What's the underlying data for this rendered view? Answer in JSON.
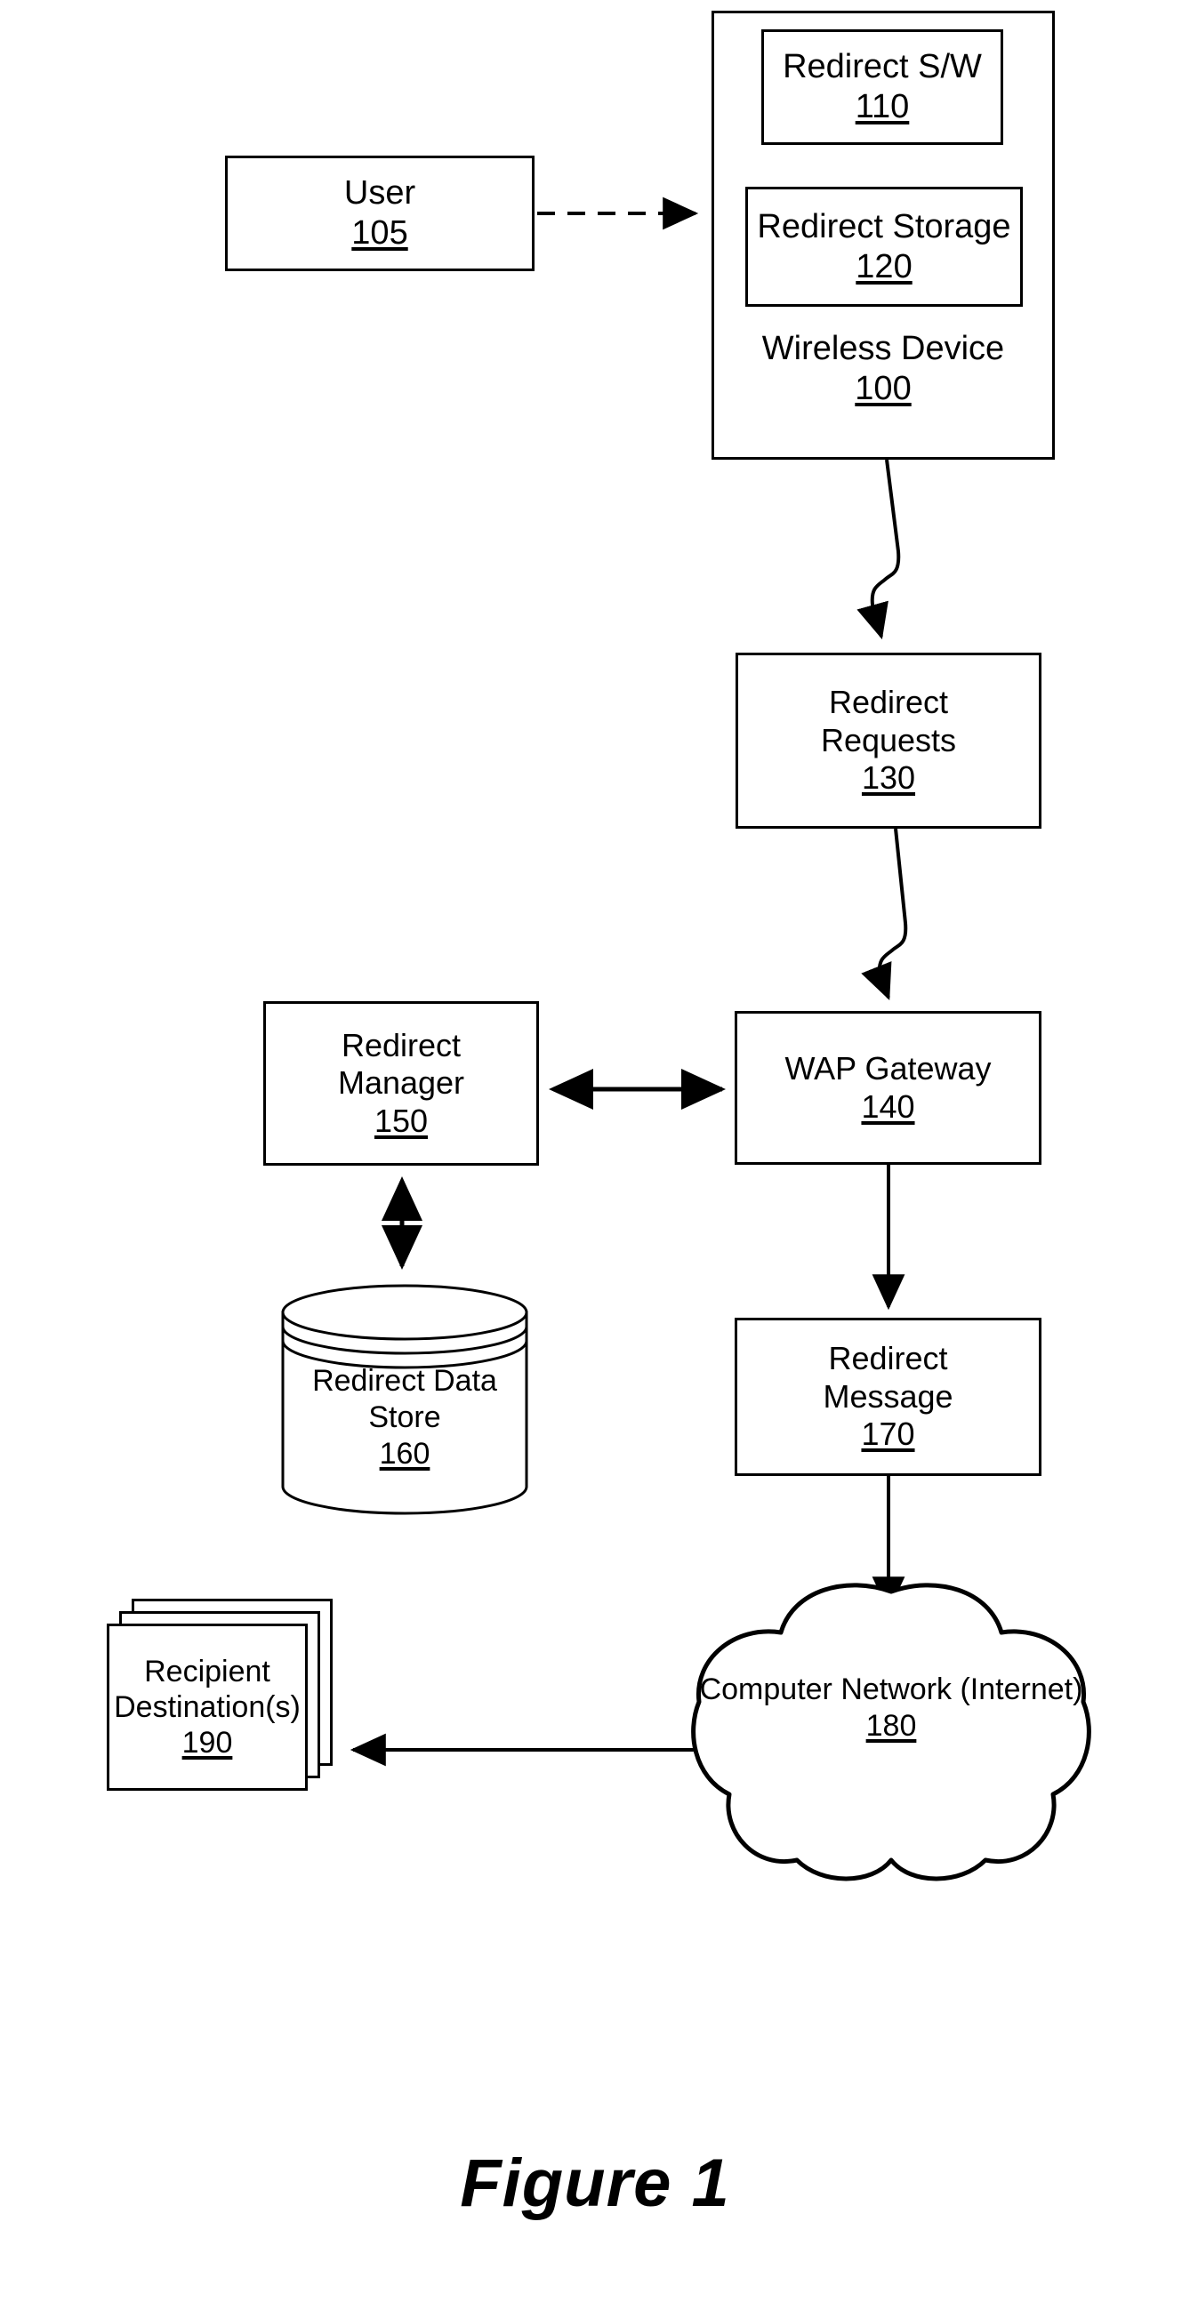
{
  "figure": {
    "caption": "Figure 1"
  },
  "nodes": {
    "user": {
      "label": "User",
      "ref": "105"
    },
    "wireless_device": {
      "label": "Wireless Device",
      "ref": "100"
    },
    "redirect_sw": {
      "label": "Redirect S/W",
      "ref": "110"
    },
    "redirect_storage": {
      "label": "Redirect Storage",
      "ref": "120"
    },
    "redirect_requests": {
      "label": "Redirect\nRequests",
      "ref": "130"
    },
    "wap_gateway": {
      "label": "WAP Gateway",
      "ref": "140"
    },
    "redirect_manager": {
      "label": "Redirect\nManager",
      "ref": "150"
    },
    "redirect_data_store": {
      "label": "Redirect Data\nStore",
      "ref": "160"
    },
    "redirect_message": {
      "label": "Redirect\nMessage",
      "ref": "170"
    },
    "computer_network": {
      "label": "Computer Network\n(Internet)",
      "ref": "180"
    },
    "recipient_destinations": {
      "label": "Recipient\nDestination(s)",
      "ref": "190"
    }
  },
  "connectors": [
    {
      "name": "user-to-wireless-device",
      "style": "dashed",
      "arrow": "single"
    },
    {
      "name": "redirect-sw-to-redirect-storage",
      "style": "solid",
      "arrow": "none"
    },
    {
      "name": "wireless-device-to-redirect-requests",
      "style": "squiggle",
      "arrow": "single"
    },
    {
      "name": "redirect-requests-to-wap-gateway",
      "style": "squiggle",
      "arrow": "single"
    },
    {
      "name": "redirect-manager-to-wap-gateway",
      "style": "solid",
      "arrow": "double"
    },
    {
      "name": "redirect-manager-to-data-store",
      "style": "solid",
      "arrow": "double"
    },
    {
      "name": "wap-gateway-to-redirect-message",
      "style": "solid",
      "arrow": "single"
    },
    {
      "name": "redirect-message-to-network",
      "style": "solid",
      "arrow": "single"
    },
    {
      "name": "network-to-recipient-destinations",
      "style": "solid",
      "arrow": "single"
    }
  ],
  "colors": {
    "ink": "#000000",
    "paper": "#ffffff"
  }
}
